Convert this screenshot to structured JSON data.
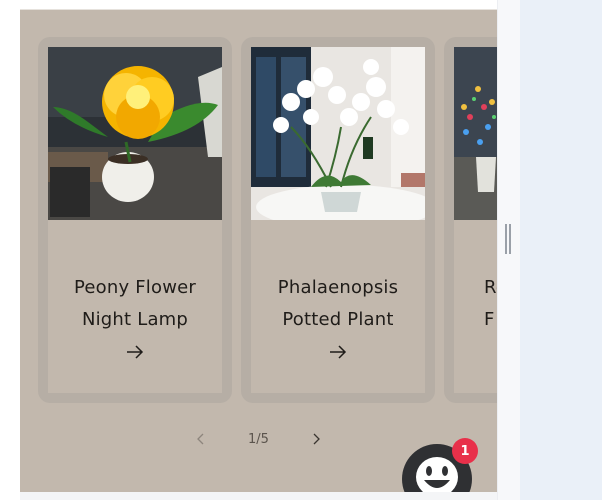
{
  "carousel": {
    "cards": [
      {
        "title": "Peony Flower\nNight Lamp",
        "image": "yellow-peony-lamp-photo",
        "arrow_icon": "arrow-right-icon"
      },
      {
        "title": "Phalaenopsis\nPotted Plant",
        "image": "white-orchid-pot-photo",
        "arrow_icon": "arrow-right-icon"
      },
      {
        "title": "Ro\nF",
        "image": "colorful-light-flowers-photo",
        "arrow_icon": "arrow-right-icon"
      }
    ],
    "pagination": {
      "text": "1/5",
      "prev_icon": "chevron-left-icon",
      "next_icon": "chevron-right-icon"
    }
  },
  "chat_widget": {
    "badge_count": "1",
    "icon": "smiley-chat-icon",
    "badge_color": "#e8304a",
    "button_color": "#2f3033"
  },
  "colors": {
    "section_bg": "#c2b8ad",
    "card_frame": "#b6aea5",
    "text": "#1f1c19"
  }
}
